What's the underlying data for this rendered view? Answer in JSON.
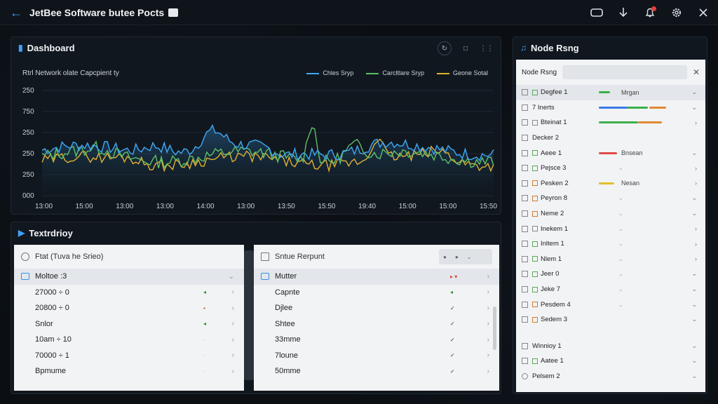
{
  "app": {
    "title": "JetBee Software butee Pocts"
  },
  "titlebar_icons": [
    "window-icon",
    "download-icon",
    "bell-icon",
    "gear-icon",
    "close-icon"
  ],
  "dashboard": {
    "title": "Dashboard",
    "actions": [
      "refresh-icon",
      "square-icon",
      "grid-icon"
    ]
  },
  "chart_data": {
    "type": "line",
    "title": "Rtrl Network olate Capcpient ty",
    "categories": [
      "13:00",
      "15:00",
      "13:00",
      "13:00",
      "14:00",
      "13:00",
      "13:50",
      "15:50",
      "19:40",
      "15:00",
      "15:00",
      "15:50"
    ],
    "yticks": [
      "250",
      "750",
      "250",
      "250",
      "250",
      "000"
    ],
    "series": [
      {
        "name": "Chles Sryp",
        "color": "#3fa9f5"
      },
      {
        "name": "Carcltlare Sryp",
        "color": "#5fbf6a"
      },
      {
        "name": "Geone Sotal",
        "color": "#e0b030"
      }
    ],
    "grid": true,
    "legend": "top-right"
  },
  "textpanel": {
    "title": "Textrdrioy",
    "listA": {
      "header": "Ftat (Tuva he Srieo)",
      "rows": [
        "Moltoe :3",
        "27000 ÷ 0",
        "20800 ÷ 0",
        "Snlor",
        "10am ÷ 10",
        "70000 ÷ 1",
        "Bpmume"
      ]
    },
    "listB": {
      "header": "Sntue Rerpunt",
      "rows": [
        "Mutter",
        "Capnte",
        "Djlee",
        "Shtee",
        "33mme",
        "7loune",
        "50mme"
      ]
    }
  },
  "nodepanel": {
    "title": "Node Rsng",
    "search_label": "Node Rsng",
    "rows": [
      {
        "label": "Degfee 1",
        "extra": "Mrgan"
      },
      {
        "label": "7 Inerts",
        "extra": ""
      },
      {
        "label": "Bteinat 1",
        "extra": ""
      },
      {
        "label": "Decker 2",
        "extra": ""
      },
      {
        "label": "Aeee 1",
        "extra": "Bnsean"
      },
      {
        "label": "Pejsce 3",
        "extra": ""
      },
      {
        "label": "Pesken 2",
        "extra": "Nesan"
      },
      {
        "label": "Peyron 8",
        "extra": ""
      },
      {
        "label": "Neme 2",
        "extra": ""
      },
      {
        "label": "Inekem 1",
        "extra": ""
      },
      {
        "label": "Inltem 1",
        "extra": ""
      },
      {
        "label": "Nlem 1",
        "extra": ""
      },
      {
        "label": "Jeer 0",
        "extra": ""
      },
      {
        "label": "Jeke 7",
        "extra": ""
      },
      {
        "label": "Pesdem 4",
        "extra": ""
      },
      {
        "label": "Sedem 3",
        "extra": ""
      },
      {
        "label": "Winnioy 1",
        "extra": ""
      },
      {
        "label": "Aatee 1",
        "extra": ""
      },
      {
        "label": "Pelsem 2",
        "extra": ""
      }
    ]
  }
}
